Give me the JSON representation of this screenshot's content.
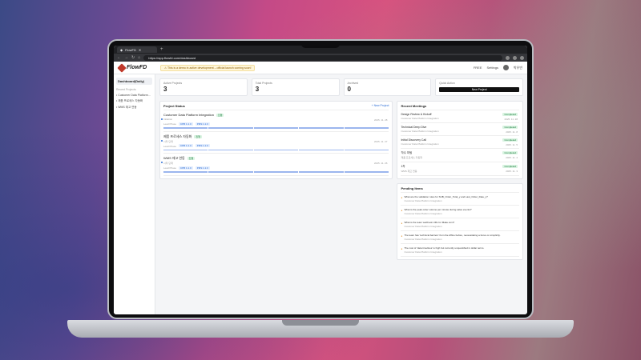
{
  "browser": {
    "tab_title": "FlowFD",
    "url": "https://app.flowfd.com/dashboard"
  },
  "header": {
    "logo": "FlowFD",
    "banner": "⚠ This is a demo in active development – official launch coming soon!",
    "free_label": "FREE",
    "settings_label": "Settings",
    "user_name": "박유빈"
  },
  "sidebar": {
    "active": "Dashboard(Daily)",
    "section": "Recent Projects",
    "items": [
      "Customer Data Platform...",
      "제품 프로세스 자동화",
      "WMS 재고 연동"
    ]
  },
  "stats": [
    {
      "label": "Active Projects",
      "value": "3"
    },
    {
      "label": "Total Projects",
      "value": "3"
    },
    {
      "label": "Archived",
      "value": "0"
    }
  ],
  "quick": {
    "label": "Quick Action",
    "button": "New Project"
  },
  "projects": {
    "title": "Project Status",
    "new_link": "+ New Project",
    "items": [
      {
        "name": "Customer Data Platform Integration",
        "badge": "진행",
        "sub": "Initiation",
        "lead": "Lead Phase",
        "chip1": "CPB 1.1.0",
        "chip2": "PMS 1.1.0",
        "date": "2025. 11. 28"
      },
      {
        "name": "제품 프로세스 자동화",
        "badge": "진행",
        "sub": "시작 단계",
        "lead": "Lead Phase",
        "chip1": "CPB 1.1.0",
        "chip2": "PMS 1.1.0",
        "date": "2025. 11. 27"
      },
      {
        "name": "WMS 재고 연동",
        "badge": "진행",
        "sub": "시작 단계",
        "lead": "Lead Phase",
        "chip1": "CPB 1.1.0",
        "chip2": "PMS 1.1.0",
        "date": "2025. 11. 26"
      }
    ]
  },
  "meetings": {
    "title": "Recent Meetings",
    "items": [
      {
        "name": "Design Review & Kickoff",
        "project": "Customer Data Platform Integration",
        "status": "Completed",
        "date": "2025. 11. 28"
      },
      {
        "name": "Technical Deep Dive",
        "project": "Customer Data Platform Integration",
        "status": "Completed",
        "date": "2025. 11. 8"
      },
      {
        "name": "Initial Discovery Call",
        "project": "Customer Data Platform Integration",
        "status": "Completed",
        "date": "2025. 11. 5"
      },
      {
        "name": "착수 미팅",
        "project": "제품 프로세스 자동화",
        "status": "Completed",
        "date": "2025. 11. 4"
      },
      {
        "name": "1차",
        "project": "WMS 재고 연동",
        "status": "Completed",
        "date": "2025. 11. 3"
      }
    ]
  },
  "pending": {
    "title": "Pending Items",
    "items": [
      {
        "text": "What are the validation rules for SUB_Order_Total_y and Last_Order_Date_y?",
        "project": "Customer Data Platform Integration"
      },
      {
        "text": "What is the peak order volume per minute during sales events?",
        "project": "Customer Data Platform Integration"
      },
      {
        "text": "What is the team webhook URL for Make.com?",
        "project": "Customer Data Platform Integration"
      },
      {
        "text": "The team has 'technical barriers' from the Affine before, necessitating a focus on simplicity.",
        "project": "Customer Data Platform Integration"
      },
      {
        "text": "The cost of 'data timelines' is high but currently unquantified in dollar terms.",
        "project": "Customer Data Platform Integration"
      }
    ]
  }
}
